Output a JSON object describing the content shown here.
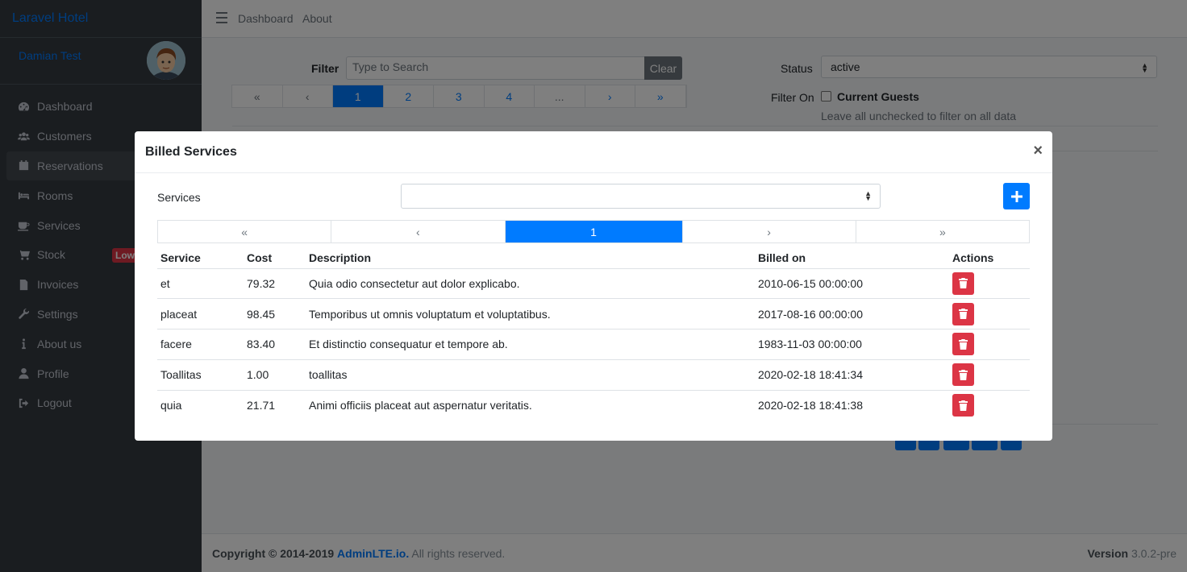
{
  "brand": "Laravel Hotel",
  "user": {
    "name": "Damian Test"
  },
  "sidebar": {
    "items": [
      {
        "label": "Dashboard",
        "icon": "dashboard-icon"
      },
      {
        "label": "Customers",
        "icon": "users-icon"
      },
      {
        "label": "Reservations",
        "icon": "calendar-icon"
      },
      {
        "label": "Rooms",
        "icon": "bed-icon"
      },
      {
        "label": "Services",
        "icon": "coffee-icon"
      },
      {
        "label": "Stock",
        "icon": "cart-icon",
        "badge": "Low"
      },
      {
        "label": "Invoices",
        "icon": "file-icon"
      },
      {
        "label": "Settings",
        "icon": "wrench-icon"
      },
      {
        "label": "About us",
        "icon": "info-icon"
      },
      {
        "label": "Profile",
        "icon": "user-icon"
      },
      {
        "label": "Logout",
        "icon": "sign-out-icon"
      }
    ]
  },
  "topnav": {
    "dashboard": "Dashboard",
    "about": "About"
  },
  "filter": {
    "label": "Filter",
    "placeholder": "Type to Search",
    "clear": "Clear"
  },
  "pager": {
    "first": "«",
    "prev": "‹",
    "pages": [
      "1",
      "2",
      "3",
      "4"
    ],
    "ellipsis": "...",
    "next": "›",
    "last": "»"
  },
  "status": {
    "label": "Status",
    "value": "active"
  },
  "filter_on": {
    "label": "Filter On",
    "current_guests": "Current Guests",
    "hint": "Leave all unchecked to filter on all data"
  },
  "footer": {
    "copyright": "Copyright © 2014-2019",
    "link": "AdminLTE.io.",
    "rights": "All rights reserved.",
    "version_label": "Version",
    "version": "3.0.2-pre"
  },
  "modal": {
    "title": "Billed Services",
    "close": "×",
    "services_label": "Services",
    "services_value": "",
    "pager": {
      "first": "«",
      "prev": "‹",
      "page": "1",
      "next": "›",
      "last": "»"
    },
    "columns": [
      "Service",
      "Cost",
      "Description",
      "Billed on",
      "Actions"
    ],
    "rows": [
      {
        "service": "et",
        "cost": "79.32",
        "description": "Quia odio consectetur aut dolor explicabo.",
        "billed_on": "2010-06-15 00:00:00"
      },
      {
        "service": "placeat",
        "cost": "98.45",
        "description": "Temporibus ut omnis voluptatum et voluptatibus.",
        "billed_on": "2017-08-16 00:00:00"
      },
      {
        "service": "facere",
        "cost": "83.40",
        "description": "Et distinctio consequatur et tempore ab.",
        "billed_on": "1983-11-03 00:00:00"
      },
      {
        "service": "Toallitas",
        "cost": "1.00",
        "description": "toallitas",
        "billed_on": "2020-02-18 18:41:34"
      },
      {
        "service": "quia",
        "cost": "21.71",
        "description": "Animi officiis placeat aut aspernatur veritatis.",
        "billed_on": "2020-02-18 18:41:38"
      }
    ]
  },
  "colors": {
    "primary": "#007bff",
    "danger": "#dc3545",
    "sidebar": "#343a40"
  }
}
